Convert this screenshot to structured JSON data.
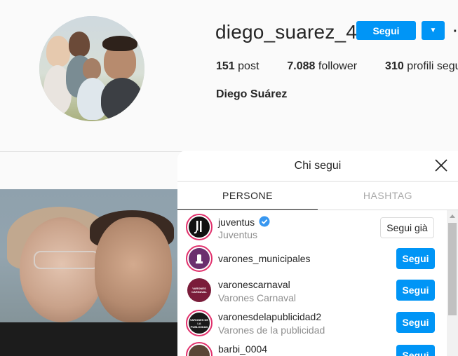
{
  "profile": {
    "username": "diego_suarez_4",
    "follow_label": "Segui",
    "dropdown_glyph": "▼",
    "more_glyph": "·",
    "posts_count": "151",
    "posts_label": "post",
    "followers_count": "7.088",
    "followers_label": "follower",
    "following_count": "310",
    "following_label": "profili segu",
    "full_name": "Diego Suárez"
  },
  "modal": {
    "title": "Chi segui",
    "tabs": [
      {
        "label": "PERSONE",
        "active": true
      },
      {
        "label": "HASHTAG",
        "active": false
      }
    ],
    "accounts": [
      {
        "username": "juventus",
        "subtitle": "Juventus",
        "verified": true,
        "button": "Segui già",
        "following": true,
        "avatar_color": "#ffffff",
        "avatar_text": "J"
      },
      {
        "username": "varones_municipales",
        "subtitle": "",
        "verified": false,
        "button": "Segui",
        "following": false,
        "avatar_color": "#6b2f6e",
        "avatar_text": ""
      },
      {
        "username": "varonescarnaval",
        "subtitle": "Varones Carnaval",
        "verified": false,
        "button": "Segui",
        "following": false,
        "avatar_color": "#7a1c3a",
        "avatar_text": "VARONES CARNAVAL"
      },
      {
        "username": "varonesdelapublicidad2",
        "subtitle": "Varones de la publicidad",
        "verified": false,
        "button": "Segui",
        "following": false,
        "avatar_color": "#1a1a1a",
        "avatar_text": "VARONES DE LA PUBLICIDAD"
      },
      {
        "username": "barbi_0004",
        "subtitle": "",
        "verified": false,
        "button": "Segui",
        "following": false,
        "avatar_color": "#5a4636",
        "avatar_text": ""
      }
    ]
  },
  "colors": {
    "accent": "#0095f6",
    "story_ring": "#e1306c",
    "verified": "#3897f0"
  }
}
